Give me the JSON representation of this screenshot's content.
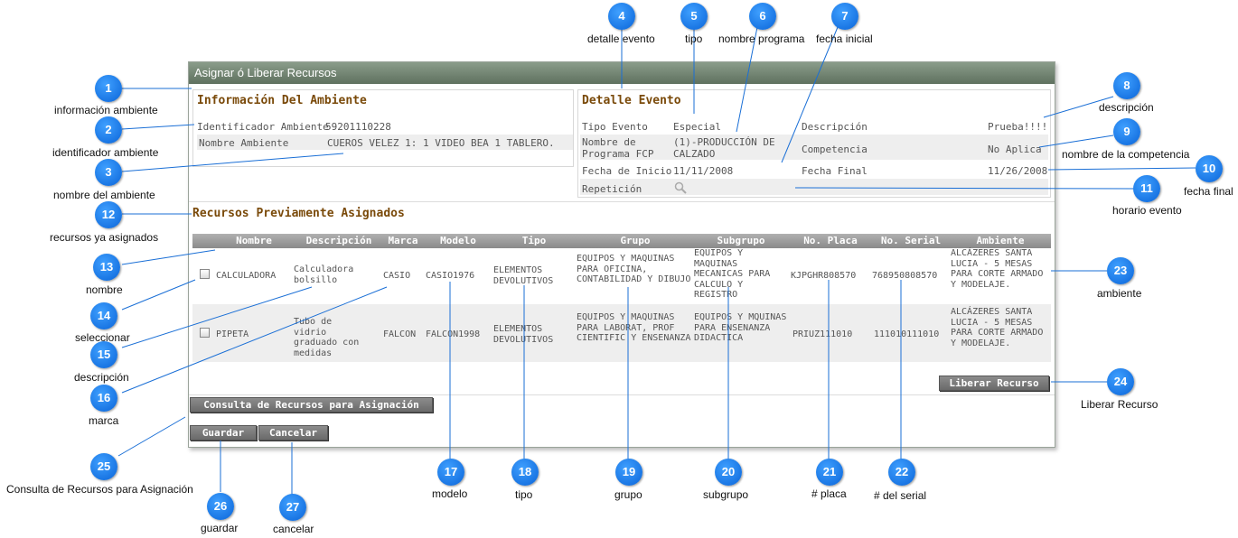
{
  "window": {
    "title": "Asignar ó Liberar Recursos"
  },
  "ambiente": {
    "title": "Información Del Ambiente",
    "id_label": "Identificador Ambiente",
    "id_value": "59201110228",
    "name_label": "Nombre Ambiente",
    "name_value": "CUEROS VELEZ 1: 1 VIDEO BEA 1 TABLERO."
  },
  "evento": {
    "title": "Detalle Evento",
    "tipo_label": "Tipo Evento",
    "tipo_value": "Especial",
    "desc_label": "Descripción",
    "desc_value": "Prueba!!!!",
    "programa_label": "Nombre de Programa FCP",
    "programa_value": "(1)-PRODUCCIÓN DE CALZADO",
    "competencia_label": "Competencia",
    "competencia_value": "No Aplica",
    "inicio_label": "Fecha de Inicio",
    "inicio_value": "11/11/2008",
    "final_label": "Fecha Final",
    "final_value": "11/26/2008",
    "repeticion_label": "Repetición"
  },
  "recursos": {
    "title": "Recursos Previamente Asignados",
    "headers": [
      "Nombre",
      "Descripción",
      "Marca",
      "Modelo",
      "Tipo",
      "Grupo",
      "Subgrupo",
      "No. Placa",
      "No. Serial",
      "Ambiente"
    ],
    "rows": [
      {
        "nombre": "CALCULADORA",
        "descripcion": "Calculadora bolsillo",
        "marca": "CASIO",
        "modelo": "CASIO1976",
        "tipo": "ELEMENTOS DEVOLUTIVOS",
        "grupo": "EQUIPOS Y MAQUINAS PARA OFICINA, CONTABILIDAD Y DIBUJO",
        "subgrupo": "EQUIPOS Y MAQUINAS MECANICAS PARA CALCULO Y REGISTRO",
        "placa": "KJPGHR808570",
        "serial": "768950808570",
        "ambiente": "ALCÁZERES SANTA LUCIA - 5 MESAS PARA CORTE ARMADO Y MODELAJE."
      },
      {
        "nombre": "PIPETA",
        "descripcion": "Tubo de vidrio graduado con medidas",
        "marca": "FALCON",
        "modelo": "FALCON1998",
        "tipo": "ELEMENTOS DEVOLUTIVOS",
        "grupo": "EQUIPOS Y MAQUINAS PARA LABORAT, PROF CIENTIFIC Y ENSENANZA",
        "subgrupo": "EQUIPOS Y MQUINAS PARA ENSENANZA DIDACTICA",
        "placa": "PRIUZ111010",
        "serial": "111010111010",
        "ambiente": "ALCÁZERES SANTA LUCIA - 5 MESAS PARA CORTE ARMADO Y MODELAJE."
      }
    ]
  },
  "buttons": {
    "liberar": "Liberar Recurso",
    "consulta": "Consulta de Recursos para Asignación",
    "guardar": "Guardar",
    "cancelar": "Cancelar"
  },
  "callouts": [
    {
      "n": "1",
      "label": "información ambiente"
    },
    {
      "n": "2",
      "label": "identificador ambiente"
    },
    {
      "n": "3",
      "label": "nombre del ambiente"
    },
    {
      "n": "4",
      "label": "detalle evento"
    },
    {
      "n": "5",
      "label": "tipo"
    },
    {
      "n": "6",
      "label": "nombre programa"
    },
    {
      "n": "7",
      "label": "fecha inicial"
    },
    {
      "n": "8",
      "label": "descripción"
    },
    {
      "n": "9",
      "label": "nombre de la competencia"
    },
    {
      "n": "10",
      "label": "fecha final"
    },
    {
      "n": "11",
      "label": "horario evento"
    },
    {
      "n": "12",
      "label": "recursos ya asignados"
    },
    {
      "n": "13",
      "label": "nombre"
    },
    {
      "n": "14",
      "label": "seleccionar"
    },
    {
      "n": "15",
      "label": "descripción"
    },
    {
      "n": "16",
      "label": "marca"
    },
    {
      "n": "17",
      "label": "modelo"
    },
    {
      "n": "18",
      "label": "tipo"
    },
    {
      "n": "19",
      "label": "grupo"
    },
    {
      "n": "20",
      "label": "subgrupo"
    },
    {
      "n": "21",
      "label": "# placa"
    },
    {
      "n": "22",
      "label": "# del serial"
    },
    {
      "n": "23",
      "label": "ambiente"
    },
    {
      "n": "24",
      "label": "Liberar Recurso"
    },
    {
      "n": "25",
      "label": "Consulta de Recursos para Asignación"
    },
    {
      "n": "26",
      "label": "guardar"
    },
    {
      "n": "27",
      "label": "cancelar"
    }
  ],
  "colors": {
    "accent": "#0a64d8",
    "section_title": "#7a4a0a",
    "header_bar": "#5f715f"
  }
}
